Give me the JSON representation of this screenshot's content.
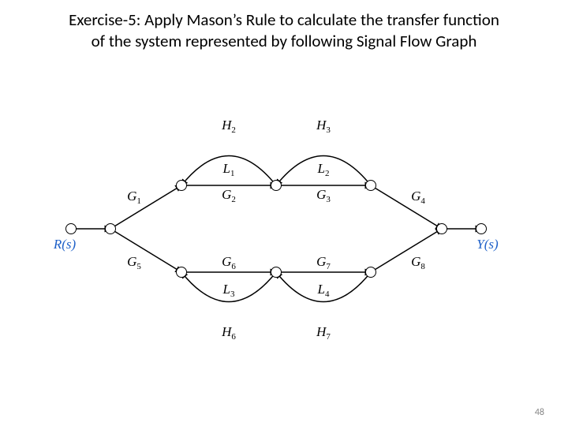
{
  "title_line1": "Exercise-5: Apply Mason’s Rule to calculate the transfer function",
  "title_line2": "of the system represented by following Signal Flow Graph",
  "page_number": "48",
  "labels": {
    "Rs": "R(s)",
    "Ys": "Y(s)",
    "G1": "G",
    "G1s": "1",
    "G2": "G",
    "G2s": "2",
    "G3": "G",
    "G3s": "3",
    "G4": "G",
    "G4s": "4",
    "G5": "G",
    "G5s": "5",
    "G6": "G",
    "G6s": "6",
    "G7": "G",
    "G7s": "7",
    "G8": "G",
    "G8s": "8",
    "H2": "H",
    "H2s": "2",
    "H3": "H",
    "H3s": "3",
    "H6": "H",
    "H6s": "6",
    "H7": "H",
    "H7s": "7",
    "L1": "L",
    "L1s": "1",
    "L2": "L",
    "L2s": "2",
    "L3": "L",
    "L3s": "3",
    "L4": "L",
    "L4s": "4"
  },
  "chart_data": {
    "type": "diagram",
    "description": "Signal Flow Graph with two forward paths from R(s) to Y(s)",
    "input": "R(s)",
    "output": "Y(s)",
    "nodes": [
      "R",
      "x1",
      "x2",
      "x3",
      "x4",
      "x5",
      "x6",
      "x7",
      "x8",
      "x9",
      "Y"
    ],
    "edges": [
      {
        "from": "R",
        "to": "x1",
        "gain": null
      },
      {
        "from": "x1",
        "to": "x2",
        "gain": "G1"
      },
      {
        "from": "x2",
        "to": "x3",
        "gain": "G2"
      },
      {
        "from": "x3",
        "to": "x4",
        "gain": "G3"
      },
      {
        "from": "x4",
        "to": "x5",
        "gain": "G4"
      },
      {
        "from": "x5",
        "to": "Y",
        "gain": null
      },
      {
        "from": "x1",
        "to": "x6",
        "gain": "G5"
      },
      {
        "from": "x6",
        "to": "x7",
        "gain": "G6"
      },
      {
        "from": "x7",
        "to": "x8",
        "gain": "G7"
      },
      {
        "from": "x8",
        "to": "x5",
        "gain": "G8"
      },
      {
        "from": "x3",
        "to": "x2",
        "gain": "H2",
        "feedback": true,
        "loop": "L1"
      },
      {
        "from": "x4",
        "to": "x3",
        "gain": "H3",
        "feedback": true,
        "loop": "L2"
      },
      {
        "from": "x7",
        "to": "x6",
        "gain": "H6",
        "feedback": true,
        "loop": "L3"
      },
      {
        "from": "x8",
        "to": "x7",
        "gain": "H7",
        "feedback": true,
        "loop": "L4"
      }
    ],
    "forward_paths": [
      [
        "G1",
        "G2",
        "G3",
        "G4"
      ],
      [
        "G5",
        "G6",
        "G7",
        "G8"
      ]
    ],
    "loops": {
      "L1": "G2*H2",
      "L2": "G3*H3",
      "L3": "G6*H6",
      "L4": "G7*H7"
    }
  }
}
